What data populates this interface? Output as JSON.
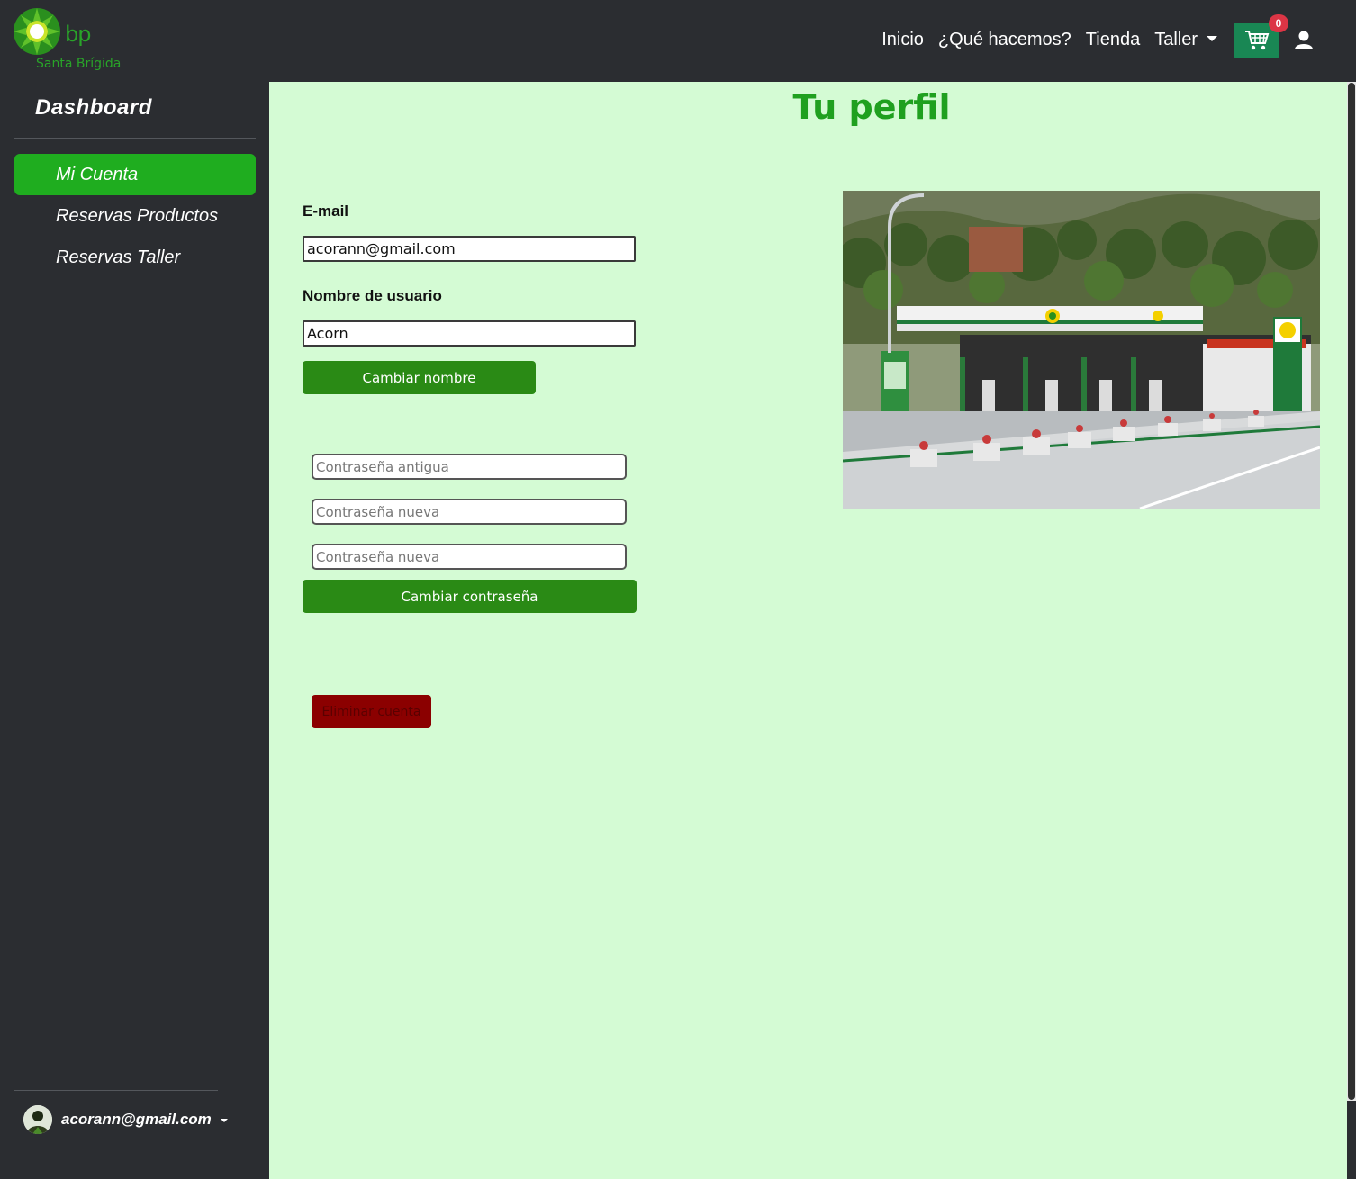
{
  "navbar": {
    "logo_text": "bp",
    "logo_subtitle": "Santa Brígida",
    "links": [
      "Inicio",
      "¿Qué hacemos?",
      "Tienda",
      "Taller"
    ],
    "cart_count": "0",
    "colors": {
      "brand_green": "#1fad1f",
      "cart_button": "#198754",
      "badge": "#dc3545"
    }
  },
  "sidebar": {
    "title": "Dashboard",
    "items": [
      {
        "label": "Mi Cuenta",
        "active": true
      },
      {
        "label": "Reservas Productos",
        "active": false
      },
      {
        "label": "Reservas Taller",
        "active": false
      }
    ],
    "user_email": "acorann@gmail.com"
  },
  "main": {
    "title": "Tu perfil",
    "email_label": "E-mail",
    "email_value": "acorann@gmail.com",
    "username_label": "Nombre de usuario",
    "username_value": "Acorn",
    "change_name_button": "Cambiar nombre",
    "old_password_placeholder": "Contraseña antigua",
    "new_password_placeholder": "Contraseña nueva",
    "confirm_password_placeholder": "Contraseña nueva",
    "change_password_button": "Cambiar contraseña",
    "delete_account_button": "Eliminar cuenta",
    "photo_icon": "gas-station-photo"
  }
}
